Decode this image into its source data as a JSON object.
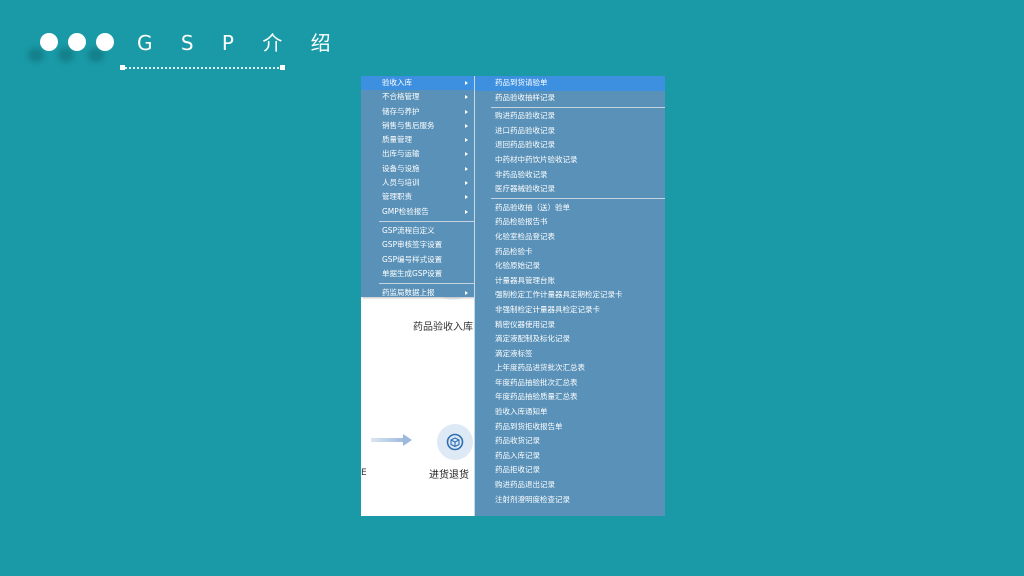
{
  "slide": {
    "title": "G S P 介 绍",
    "colors": {
      "background": "#199aa6",
      "menu": "#5991b8",
      "menu_highlight": "#3d8fe0"
    }
  },
  "background_screen": {
    "label_1": "药品验收入库",
    "label_2": "进货退货",
    "fragment": "E"
  },
  "menu_left": {
    "group1": [
      {
        "label": "验收入库",
        "submenu": true,
        "active": true
      },
      {
        "label": "不合格管理",
        "submenu": true
      },
      {
        "label": "储存与养护",
        "submenu": true
      },
      {
        "label": "销售与售后服务",
        "submenu": true
      },
      {
        "label": "质量管理",
        "submenu": true
      },
      {
        "label": "出库与运输",
        "submenu": true
      },
      {
        "label": "设备与设施",
        "submenu": true
      },
      {
        "label": "人员与培训",
        "submenu": true
      },
      {
        "label": "管理职责",
        "submenu": true
      },
      {
        "label": "GMP检验报告",
        "submenu": true
      }
    ],
    "group2": [
      {
        "label": "GSP流程自定义"
      },
      {
        "label": "GSP审核签字设置"
      },
      {
        "label": "GSP编号样式设置"
      },
      {
        "label": "单据生成GSP设置"
      }
    ],
    "group3": [
      {
        "label": "药监局数据上报",
        "submenu": true
      }
    ]
  },
  "menu_right": {
    "group1": [
      {
        "label": "药品到货请验单",
        "active": true
      },
      {
        "label": "药品验收抽样记录"
      }
    ],
    "group2": [
      {
        "label": "购进药品验收记录"
      },
      {
        "label": "进口药品验收记录"
      },
      {
        "label": "退回药品验收记录"
      },
      {
        "label": "中药材中药饮片验收记录"
      },
      {
        "label": "非药品验收记录"
      },
      {
        "label": "医疗器械验收记录"
      }
    ],
    "group3": [
      {
        "label": "药品验收抽（送）验单"
      },
      {
        "label": "药品检验报告书"
      },
      {
        "label": "化验室检品登记表"
      },
      {
        "label": "药品检验卡"
      },
      {
        "label": "化验原始记录"
      },
      {
        "label": "计量器具管理台账"
      },
      {
        "label": "强制检定工作计量器具定期检定记录卡"
      },
      {
        "label": "非强制检定计量器具检定记录卡"
      },
      {
        "label": "精密仪器使用记录"
      },
      {
        "label": "滴定液配制及标化记录"
      },
      {
        "label": "滴定液标签"
      },
      {
        "label": "上年度药品进货批次汇总表"
      },
      {
        "label": "年度药品抽验批次汇总表"
      },
      {
        "label": "年度药品抽验质量汇总表"
      },
      {
        "label": "验收入库通知单"
      },
      {
        "label": "药品到货拒收报告单"
      },
      {
        "label": "药品收货记录"
      },
      {
        "label": "药品入库记录"
      },
      {
        "label": "药品拒收记录"
      },
      {
        "label": "购进药品退出记录"
      },
      {
        "label": "注射剂澄明度检查记录"
      }
    ]
  }
}
